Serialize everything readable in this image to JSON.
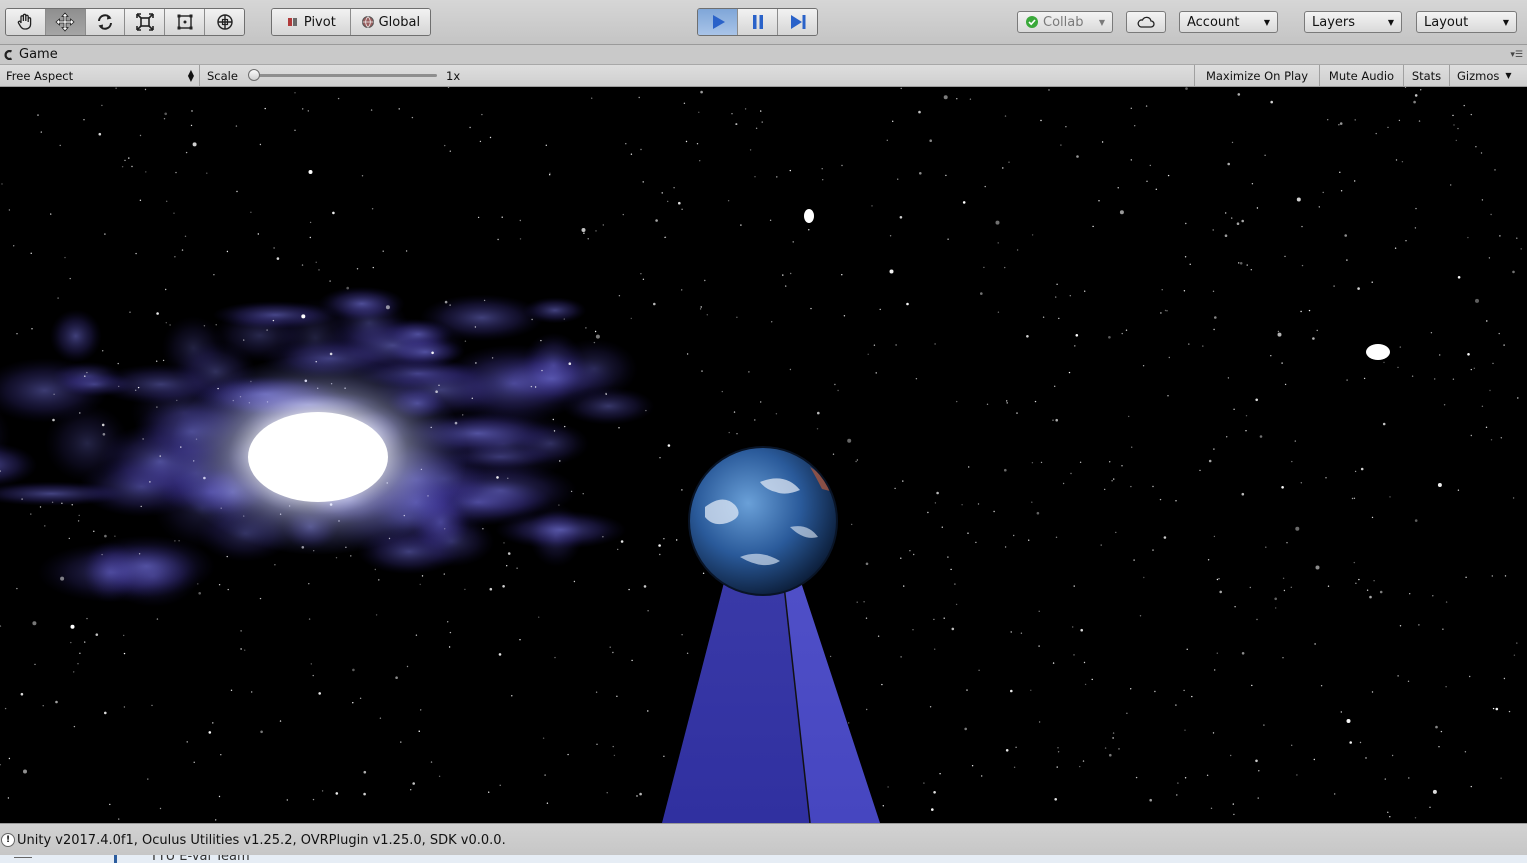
{
  "toolbar": {
    "tools": [
      {
        "name": "hand-tool",
        "icon": "hand-icon"
      },
      {
        "name": "move-tool",
        "icon": "move-arrows-icon",
        "active": true
      },
      {
        "name": "rotate-tool",
        "icon": "rotate-icon"
      },
      {
        "name": "scale-tool",
        "icon": "scale-icon"
      },
      {
        "name": "rect-tool",
        "icon": "rect-transform-icon"
      },
      {
        "name": "transform-tool",
        "icon": "transform-icon"
      }
    ],
    "pivot_label": "Pivot",
    "global_label": "Global",
    "collab_label": "Collab",
    "account_label": "Account",
    "layers_label": "Layers",
    "layout_label": "Layout",
    "play_accent": "#2a62c9"
  },
  "game_tab": {
    "title": "Game"
  },
  "game_bar": {
    "aspect": "Free Aspect",
    "scale_label": "Scale",
    "scale_value": "1x",
    "scale_level": 0,
    "maximize_on_play": "Maximize On Play",
    "mute_audio": "Mute Audio",
    "stats": "Stats",
    "gizmos": "Gizmos"
  },
  "status": {
    "message": "Unity v2017.4.0f1, Oculus Utilities v1.25.2, OVRPlugin v1.25.0, SDK v0.0.0."
  },
  "taskbar": {
    "window_title": "TTU E-val Team"
  }
}
